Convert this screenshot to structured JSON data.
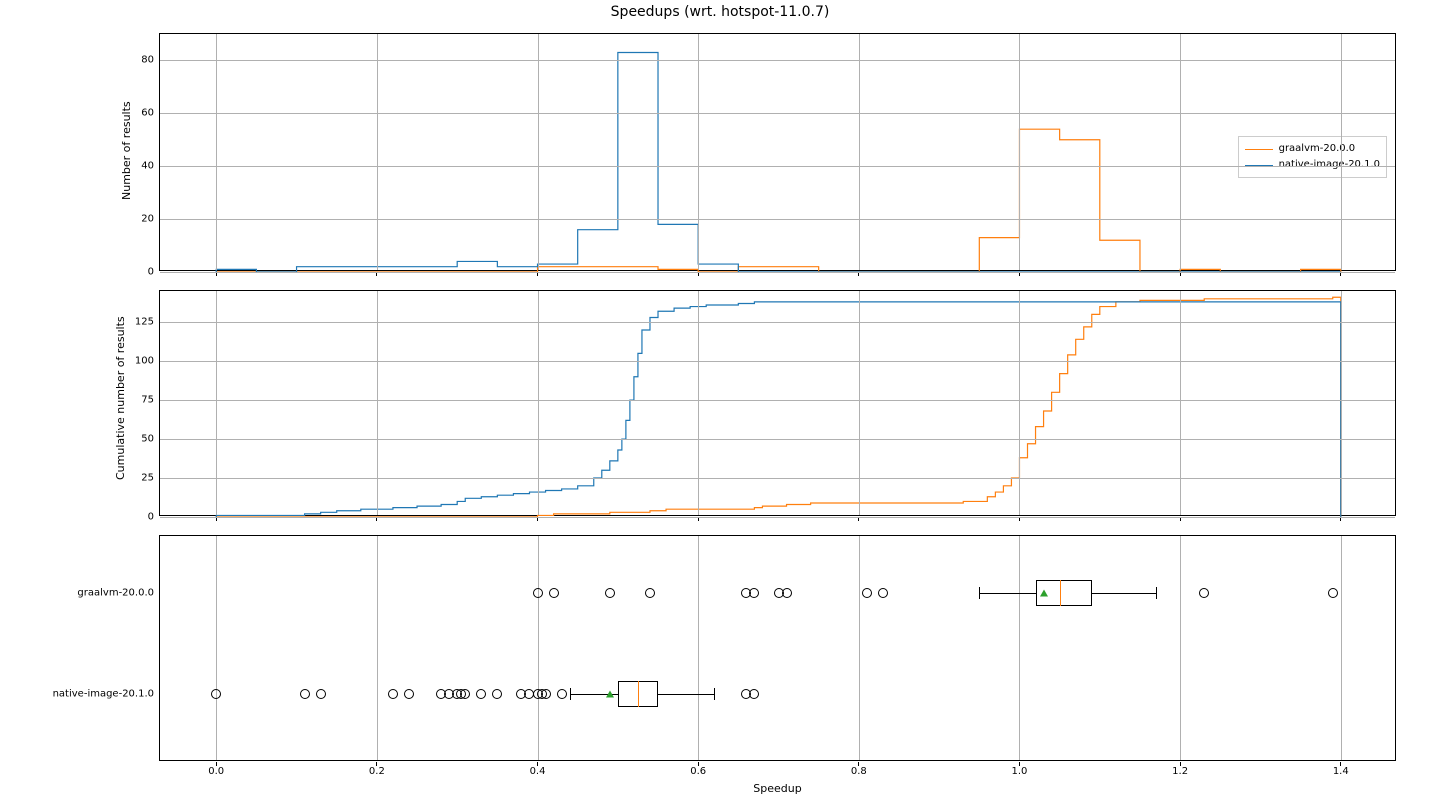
{
  "chart_data": [
    {
      "type": "histogram-step",
      "title": "Speedups (wrt. hotspot-11.0.7)",
      "xlabel": "",
      "ylabel": "Number of results",
      "xlim": [
        -0.07,
        1.47
      ],
      "ylim": [
        0,
        90
      ],
      "xticks": [
        0.0,
        0.2,
        0.4,
        0.6,
        0.8,
        1.0,
        1.2,
        1.4
      ],
      "yticks": [
        0,
        20,
        40,
        60,
        80
      ],
      "bin_edges": [
        0.0,
        0.05,
        0.1,
        0.15,
        0.2,
        0.25,
        0.3,
        0.35,
        0.4,
        0.45,
        0.5,
        0.55,
        0.6,
        0.65,
        0.7,
        0.75,
        0.8,
        0.85,
        0.9,
        0.95,
        1.0,
        1.05,
        1.1,
        1.15,
        1.2,
        1.25,
        1.3,
        1.35,
        1.4
      ],
      "series": [
        {
          "name": "graalvm-20.0.0",
          "color": "#ff7f0e",
          "counts": [
            0,
            0,
            0,
            0,
            0,
            0,
            0,
            0,
            2,
            2,
            2,
            1,
            0,
            2,
            2,
            0,
            0,
            0,
            0,
            13,
            54,
            50,
            12,
            0,
            1,
            0,
            0,
            1
          ]
        },
        {
          "name": "native-image-20.1.0",
          "color": "#1f77b4",
          "counts": [
            1,
            0,
            2,
            2,
            2,
            2,
            4,
            2,
            3,
            16,
            83,
            18,
            3,
            0,
            0,
            0,
            0,
            0,
            0,
            0,
            0,
            0,
            0,
            0,
            0,
            0,
            0,
            0
          ]
        }
      ],
      "legend": [
        "graalvm-20.0.0",
        "native-image-20.1.0"
      ]
    },
    {
      "type": "cumulative-step",
      "xlabel": "",
      "ylabel": "Cumulative number of results",
      "xlim": [
        -0.07,
        1.47
      ],
      "ylim": [
        0,
        145
      ],
      "xticks": [
        0.0,
        0.2,
        0.4,
        0.6,
        0.8,
        1.0,
        1.2,
        1.4
      ],
      "yticks": [
        0,
        25,
        50,
        75,
        100,
        125
      ],
      "series": [
        {
          "name": "graalvm-20.0.0",
          "color": "#ff7f0e",
          "points": [
            [
              0.0,
              0
            ],
            [
              0.4,
              1
            ],
            [
              0.41,
              1
            ],
            [
              0.42,
              2
            ],
            [
              0.48,
              2
            ],
            [
              0.49,
              3
            ],
            [
              0.52,
              3
            ],
            [
              0.54,
              4
            ],
            [
              0.56,
              5
            ],
            [
              0.66,
              5
            ],
            [
              0.67,
              6
            ],
            [
              0.68,
              7
            ],
            [
              0.7,
              7
            ],
            [
              0.71,
              8
            ],
            [
              0.73,
              8
            ],
            [
              0.74,
              9
            ],
            [
              0.92,
              9
            ],
            [
              0.93,
              10
            ],
            [
              0.96,
              13
            ],
            [
              0.97,
              16
            ],
            [
              0.98,
              20
            ],
            [
              0.99,
              25
            ],
            [
              1.0,
              38
            ],
            [
              1.01,
              47
            ],
            [
              1.02,
              58
            ],
            [
              1.03,
              68
            ],
            [
              1.04,
              80
            ],
            [
              1.05,
              92
            ],
            [
              1.06,
              104
            ],
            [
              1.07,
              114
            ],
            [
              1.08,
              122
            ],
            [
              1.09,
              130
            ],
            [
              1.1,
              135
            ],
            [
              1.12,
              138
            ],
            [
              1.15,
              139
            ],
            [
              1.22,
              139
            ],
            [
              1.23,
              140
            ],
            [
              1.38,
              140
            ],
            [
              1.39,
              141
            ],
            [
              1.4,
              141
            ],
            [
              1.4,
              0
            ]
          ]
        },
        {
          "name": "native-image-20.1.0",
          "color": "#1f77b4",
          "points": [
            [
              0.0,
              0
            ],
            [
              0.0,
              1
            ],
            [
              0.11,
              2
            ],
            [
              0.13,
              3
            ],
            [
              0.15,
              4
            ],
            [
              0.18,
              5
            ],
            [
              0.22,
              6
            ],
            [
              0.25,
              7
            ],
            [
              0.28,
              8
            ],
            [
              0.3,
              10
            ],
            [
              0.31,
              12
            ],
            [
              0.33,
              13
            ],
            [
              0.35,
              14
            ],
            [
              0.37,
              15
            ],
            [
              0.39,
              16
            ],
            [
              0.41,
              17
            ],
            [
              0.43,
              18
            ],
            [
              0.45,
              20
            ],
            [
              0.47,
              25
            ],
            [
              0.48,
              30
            ],
            [
              0.49,
              36
            ],
            [
              0.5,
              43
            ],
            [
              0.505,
              50
            ],
            [
              0.51,
              62
            ],
            [
              0.515,
              75
            ],
            [
              0.52,
              90
            ],
            [
              0.525,
              105
            ],
            [
              0.53,
              120
            ],
            [
              0.54,
              128
            ],
            [
              0.55,
              132
            ],
            [
              0.57,
              134
            ],
            [
              0.59,
              135
            ],
            [
              0.61,
              136
            ],
            [
              0.65,
              137
            ],
            [
              0.67,
              138
            ],
            [
              0.7,
              138
            ],
            [
              1.4,
              138
            ],
            [
              1.4,
              0
            ]
          ]
        }
      ]
    },
    {
      "type": "boxplot",
      "xlabel": "Speedup",
      "ylabel": "",
      "xlim": [
        -0.07,
        1.47
      ],
      "xticks": [
        0.0,
        0.2,
        0.4,
        0.6,
        0.8,
        1.0,
        1.2,
        1.4
      ],
      "categories": [
        "graalvm-20.0.0",
        "native-image-20.1.0"
      ],
      "boxes": [
        {
          "name": "graalvm-20.0.0",
          "whisker_lo": 0.95,
          "q1": 1.02,
          "median": 1.05,
          "q3": 1.09,
          "whisker_hi": 1.17,
          "mean": 1.03,
          "outliers": [
            0.4,
            0.42,
            0.49,
            0.54,
            0.66,
            0.67,
            0.7,
            0.71,
            0.81,
            0.83,
            1.23,
            1.39
          ]
        },
        {
          "name": "native-image-20.1.0",
          "whisker_lo": 0.44,
          "q1": 0.5,
          "median": 0.525,
          "q3": 0.55,
          "whisker_hi": 0.62,
          "mean": 0.49,
          "outliers": [
            0.0,
            0.11,
            0.13,
            0.22,
            0.24,
            0.28,
            0.29,
            0.3,
            0.305,
            0.31,
            0.33,
            0.35,
            0.38,
            0.39,
            0.4,
            0.405,
            0.41,
            0.43,
            0.66,
            0.67
          ]
        }
      ]
    }
  ],
  "title": "Speedups (wrt. hotspot-11.0.7)",
  "xlabel_bottom": "Speedup",
  "colors": {
    "orange": "#ff7f0e",
    "blue": "#1f77b4",
    "green": "#2ca02c"
  }
}
